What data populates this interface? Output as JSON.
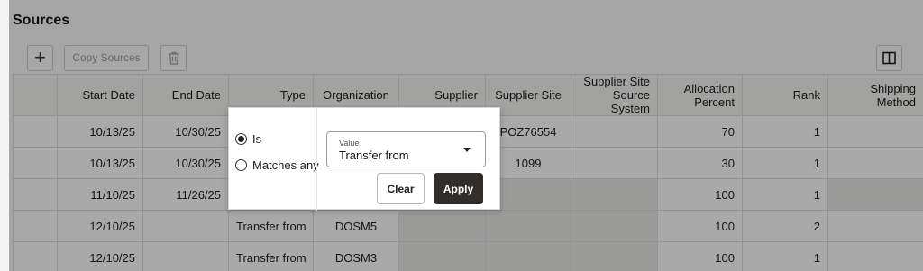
{
  "page": {
    "title": "Sources"
  },
  "toolbar": {
    "add_label": "+",
    "copy_label": "Copy Sources",
    "delete_icon": "trash-icon",
    "columns_icon": "columns-icon"
  },
  "table": {
    "headers": [
      "",
      "Start Date",
      "End Date",
      "Type",
      "Organization",
      "Supplier",
      "Supplier Site",
      "Supplier Site Source System",
      "Allocation Percent",
      "Rank",
      "Shipping Method"
    ],
    "rows": [
      [
        "",
        "10/13/25",
        "10/30/25",
        "",
        "",
        "",
        "POZ76554",
        "",
        "70",
        "1",
        ""
      ],
      [
        "",
        "10/13/25",
        "10/30/25",
        "",
        "",
        "",
        "1099",
        "",
        "30",
        "1",
        ""
      ],
      [
        "",
        "11/10/25",
        "11/26/25",
        "",
        "",
        "",
        "",
        "",
        "100",
        "1",
        ""
      ],
      [
        "",
        "12/10/25",
        "",
        "Transfer from",
        "DOSM5",
        "",
        "",
        "",
        "100",
        "2",
        ""
      ],
      [
        "",
        "12/10/25",
        "",
        "Transfer from",
        "DOSM3",
        "",
        "",
        "",
        "100",
        "1",
        ""
      ]
    ]
  },
  "filter_popup": {
    "option_is": "Is",
    "option_matches": "Matches any",
    "selected_option": "Is",
    "value_label": "Value",
    "value": "Transfer from",
    "clear_label": "Clear",
    "apply_label": "Apply"
  }
}
